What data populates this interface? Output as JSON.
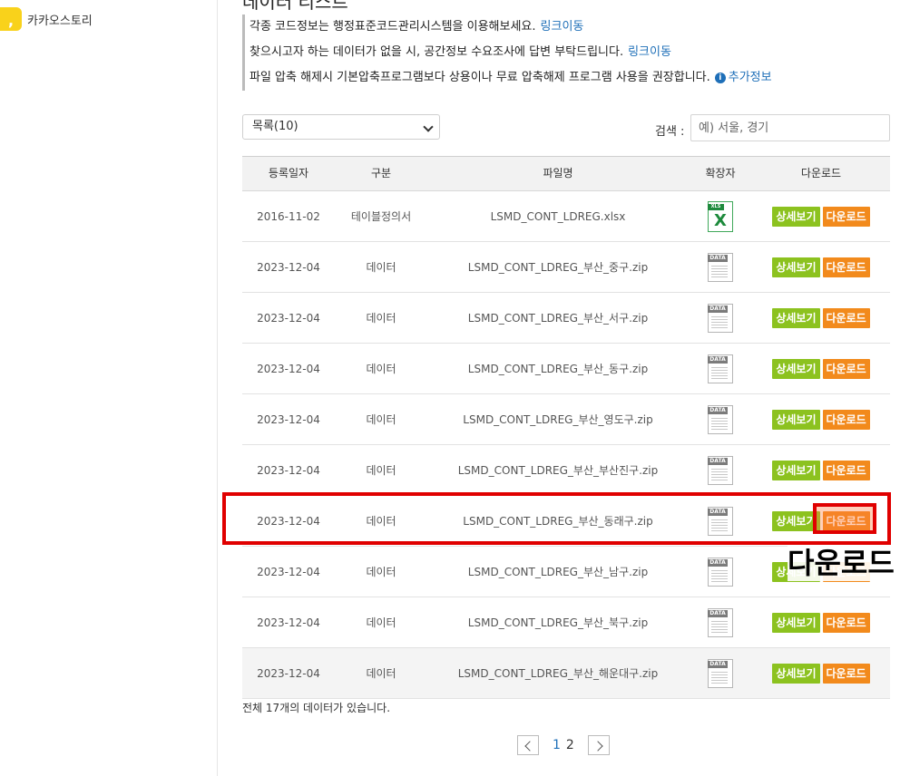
{
  "sidebar": {
    "share_items": [
      {
        "label": "카카오스토리",
        "icon": "kakaostory-icon"
      }
    ]
  },
  "main": {
    "title": "데이터 리스트",
    "notices": [
      {
        "text": "각종 코드정보는 행정표준코드관리시스템을 이용해보세요.",
        "link": "링크이동"
      },
      {
        "text": "찾으시고자 하는 데이터가 없을 시, 공간정보 수요조사에 답변 부탁드립니다.",
        "link": "링크이동"
      },
      {
        "text": "파일 압축 해제시 기본압축프로그램보다 상용이나 무료 압축해제 프로그램 사용을 권장합니다.",
        "link": "추가정보",
        "link_icon": "info-icon"
      }
    ],
    "list_size_select": {
      "value": "목록(10)"
    },
    "search": {
      "label": "검색 :",
      "placeholder": "예) 서울, 경기"
    },
    "table": {
      "columns": [
        "등록일자",
        "구분",
        "파일명",
        "확장자",
        "다운로드"
      ],
      "detail_label": "상세보기",
      "download_label": "다운로드",
      "rows": [
        {
          "date": "2016-11-02",
          "type": "테이블정의서",
          "file": "LSMD_CONT_LDREG.xlsx",
          "ext": "xls"
        },
        {
          "date": "2023-12-04",
          "type": "데이터",
          "file": "LSMD_CONT_LDREG_부산_중구.zip",
          "ext": "data"
        },
        {
          "date": "2023-12-04",
          "type": "데이터",
          "file": "LSMD_CONT_LDREG_부산_서구.zip",
          "ext": "data"
        },
        {
          "date": "2023-12-04",
          "type": "데이터",
          "file": "LSMD_CONT_LDREG_부산_동구.zip",
          "ext": "data"
        },
        {
          "date": "2023-12-04",
          "type": "데이터",
          "file": "LSMD_CONT_LDREG_부산_영도구.zip",
          "ext": "data"
        },
        {
          "date": "2023-12-04",
          "type": "데이터",
          "file": "LSMD_CONT_LDREG_부산_부산진구.zip",
          "ext": "data"
        },
        {
          "date": "2023-12-04",
          "type": "데이터",
          "file": "LSMD_CONT_LDREG_부산_동래구.zip",
          "ext": "data"
        },
        {
          "date": "2023-12-04",
          "type": "데이터",
          "file": "LSMD_CONT_LDREG_부산_남구.zip",
          "ext": "data"
        },
        {
          "date": "2023-12-04",
          "type": "데이터",
          "file": "LSMD_CONT_LDREG_부산_북구.zip",
          "ext": "data"
        },
        {
          "date": "2023-12-04",
          "type": "데이터",
          "file": "LSMD_CONT_LDREG_부산_해운대구.zip",
          "ext": "data"
        }
      ]
    },
    "total_text": "전체 17개의 데이터가 있습니다.",
    "pagination": {
      "pages": [
        "1",
        "2"
      ],
      "current": "1"
    }
  },
  "annotation": {
    "callout_text": "다운로드",
    "color": "#e00000"
  },
  "colors": {
    "detail_button": "#8cc21f",
    "download_button": "#f28a1c",
    "link": "#1e6fb8"
  }
}
